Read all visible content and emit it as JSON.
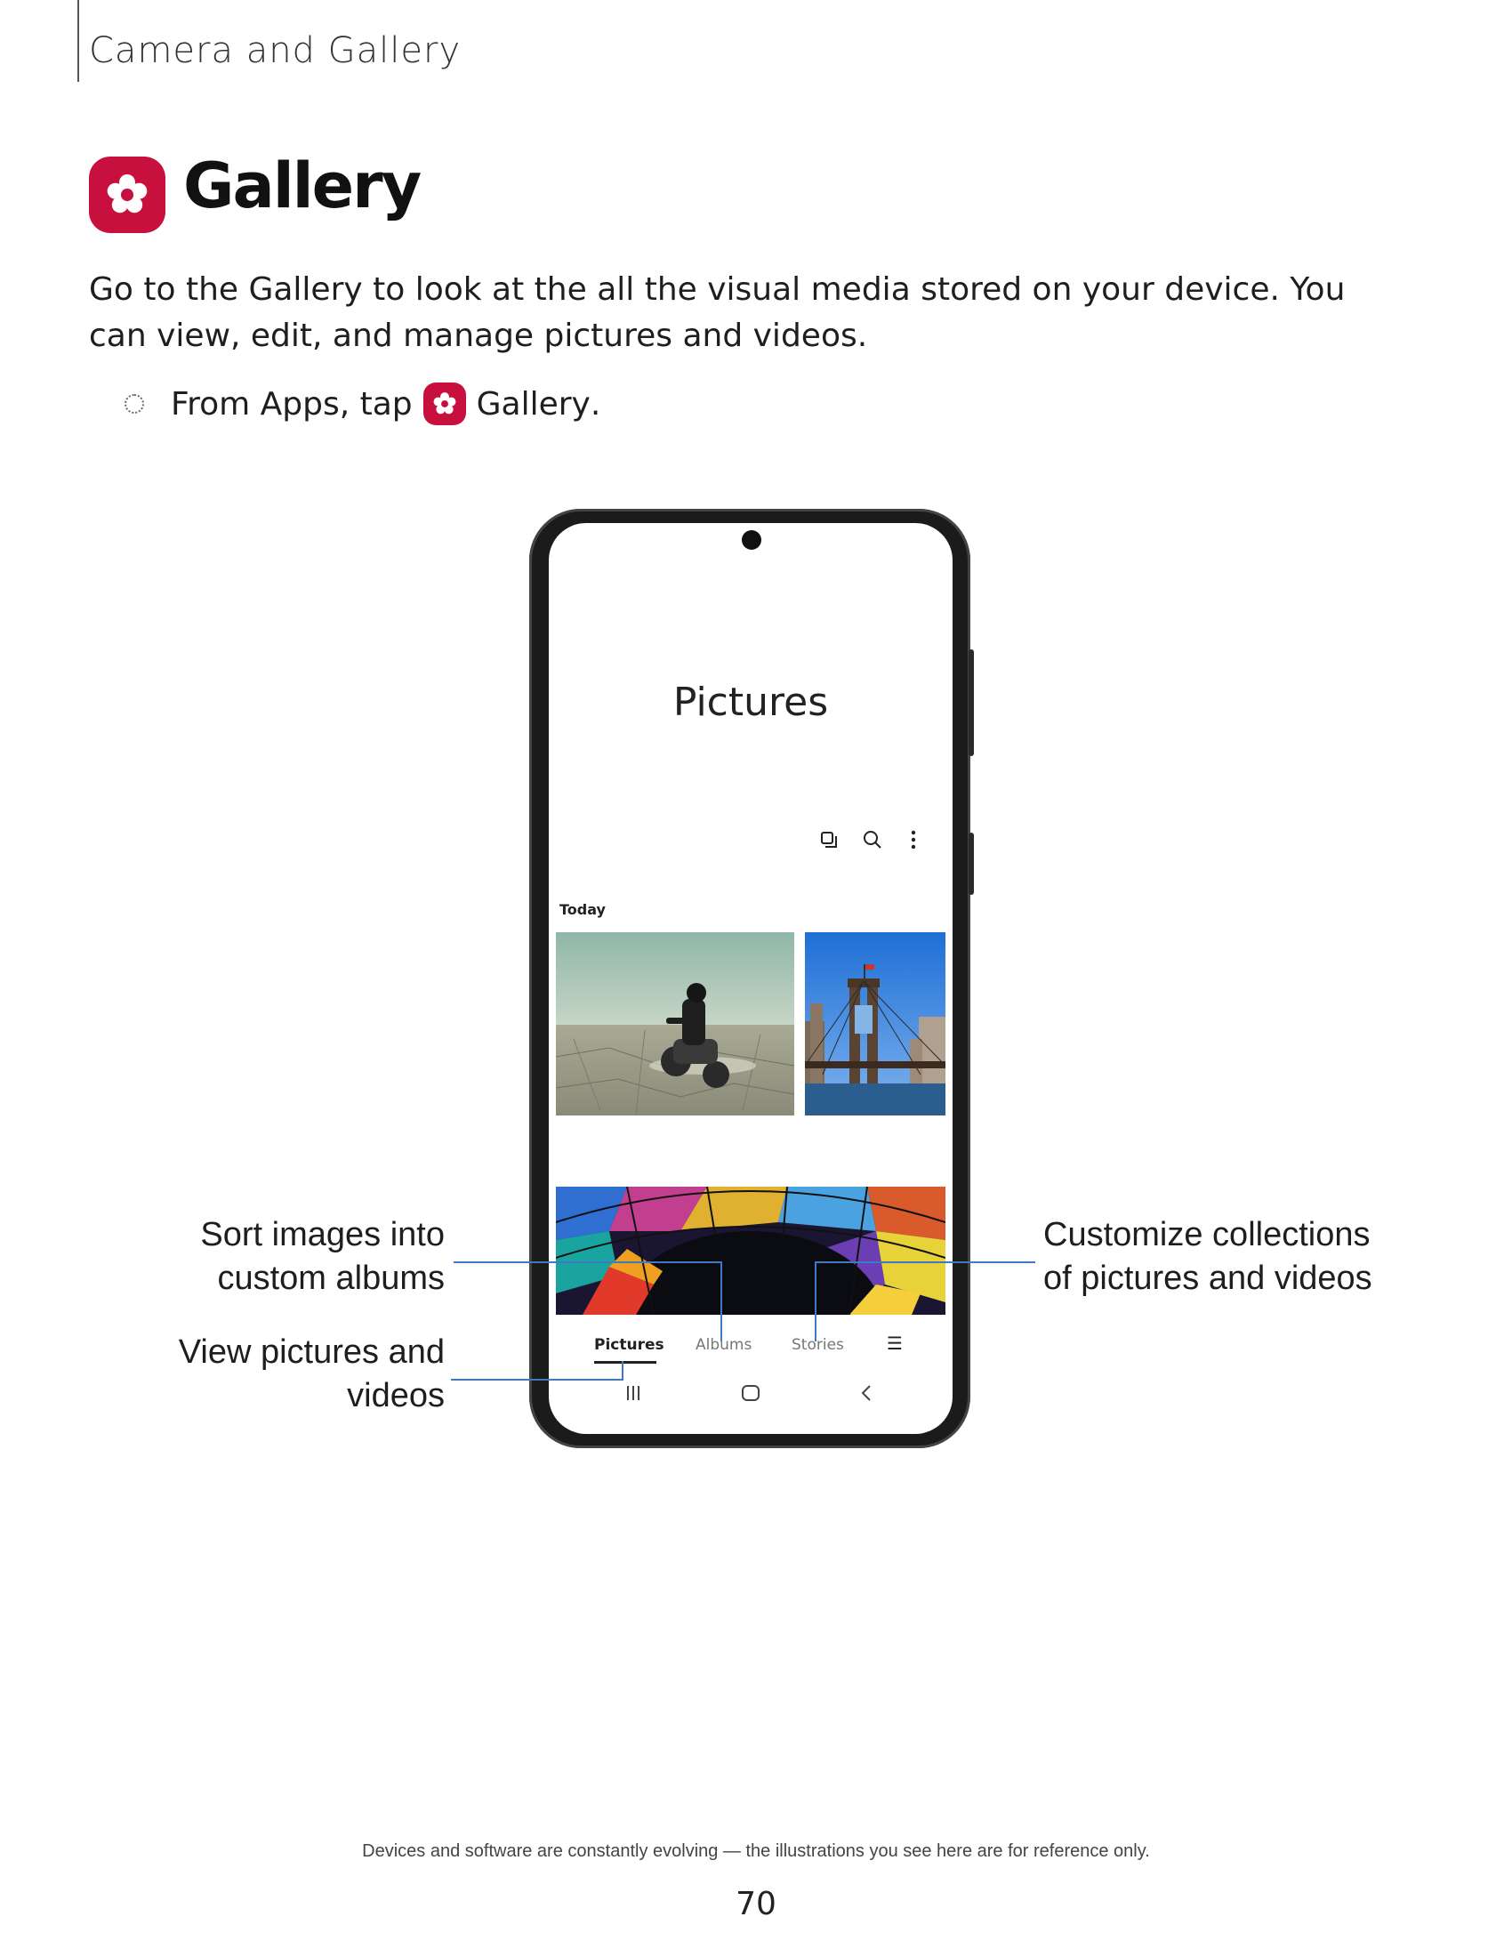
{
  "header": {
    "section_title": "Camera and Gallery"
  },
  "page": {
    "title": "Gallery",
    "title_icon": "gallery-flower-icon",
    "intro": "Go to the Gallery to look at the all the visual media stored on your device. You can view, edit, and manage pictures and videos.",
    "step": {
      "prefix": "From Apps, tap",
      "app_name": "Gallery",
      "suffix": "."
    },
    "accent_color": "#c8103e"
  },
  "phone": {
    "screen_title": "Pictures",
    "toolbar_icons": [
      "select-icon",
      "search-icon",
      "more-options-icon"
    ],
    "section_label": "Today",
    "tabs": [
      "Pictures",
      "Albums",
      "Stories",
      "☰"
    ],
    "active_tab": "Pictures",
    "nav_icons": [
      "recent-apps-icon",
      "home-icon",
      "back-icon"
    ],
    "photos": [
      "motorcycle-desert-photo",
      "bridge-skyline-photo",
      "stained-glass-photo"
    ]
  },
  "callouts": {
    "albums": "Sort images into custom albums",
    "pictures": "View pictures and videos",
    "stories": "Customize collections of pictures and videos",
    "leader_color": "#3f79c4"
  },
  "footer": {
    "note": "Devices and software are constantly evolving — the illustrations you see here are for reference only.",
    "page_number": "70"
  }
}
